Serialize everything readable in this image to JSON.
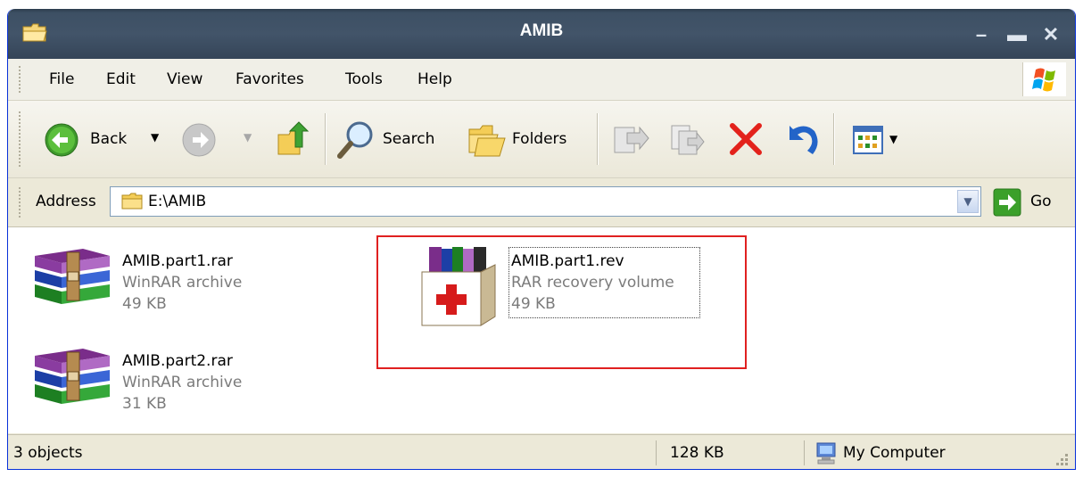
{
  "window": {
    "title": "AMIB"
  },
  "menu": [
    {
      "label": "File"
    },
    {
      "label": "Edit"
    },
    {
      "label": "View"
    },
    {
      "label": "Favorites"
    },
    {
      "label": "Tools"
    },
    {
      "label": "Help"
    }
  ],
  "toolbar": {
    "back_label": "Back",
    "search_label": "Search",
    "folders_label": "Folders"
  },
  "address": {
    "label": "Address",
    "value": "E:\\AMIB",
    "go_label": "Go"
  },
  "files": [
    {
      "name": "AMIB.part1.rar",
      "type": "WinRAR archive",
      "size": "49 KB",
      "icon": "winrar-archive-icon"
    },
    {
      "name": "AMIB.part2.rar",
      "type": "WinRAR archive",
      "size": "31 KB",
      "icon": "winrar-archive-icon"
    },
    {
      "name": "AMIB.part1.rev",
      "type": "RAR recovery volume",
      "size": "49 KB",
      "icon": "rar-recovery-icon"
    }
  ],
  "status": {
    "objects": "3 objects",
    "total_size": "128 KB",
    "location": "My Computer"
  },
  "colors": {
    "highlight_rect": "#e02020",
    "titlebar": "#425469"
  }
}
